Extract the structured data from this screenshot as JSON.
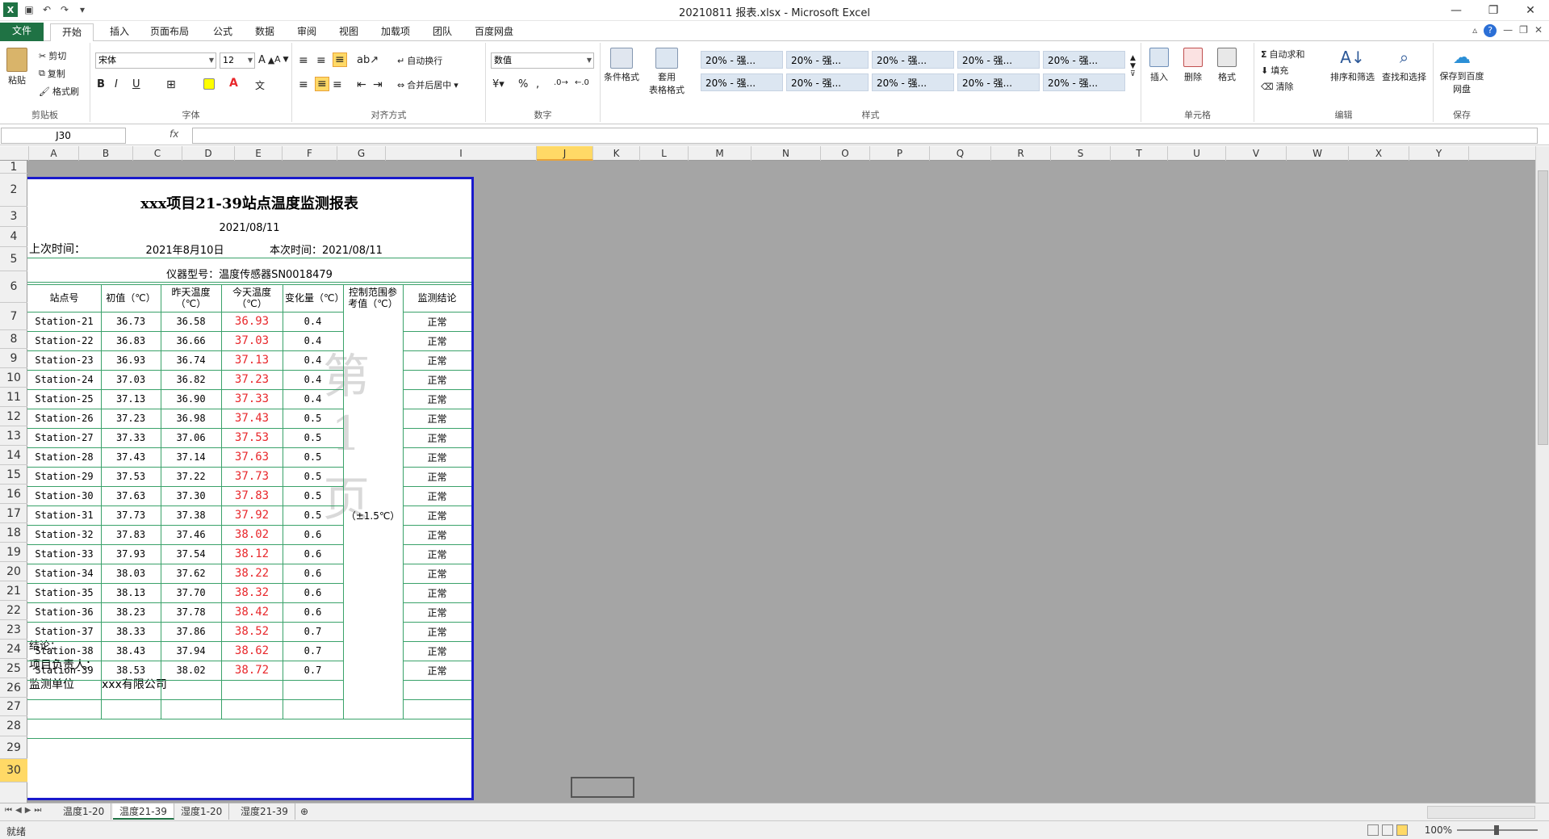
{
  "window": {
    "title": "20210811 报表.xlsx - Microsoft Excel",
    "min": "—",
    "max": "❐",
    "close": "✕"
  },
  "ribbon_tabs": [
    "文件",
    "开始",
    "插入",
    "页面布局",
    "公式",
    "数据",
    "审阅",
    "视图",
    "加载项",
    "团队",
    "百度网盘"
  ],
  "ribbon": {
    "clipboard": {
      "paste": "粘贴",
      "cut": "剪切",
      "copy": "复制",
      "format_painter": "格式刷",
      "label": "剪贴板"
    },
    "font": {
      "name": "宋体",
      "size": "12",
      "label": "字体",
      "bold": "B",
      "italic": "I",
      "underline": "U"
    },
    "alignment": {
      "wrap": "自动换行",
      "merge": "合并后居中",
      "label": "对齐方式"
    },
    "number": {
      "format": "数值",
      "percent": "%",
      "comma": ",",
      "label": "数字"
    },
    "styles": {
      "conditional": "条件格式",
      "table": "套用\n表格格式",
      "label": "样式",
      "cells": [
        "20% - 强...",
        "20% - 强...",
        "20% - 强...",
        "20% - 强...",
        "20% - 强...",
        "20% - 强...",
        "20% - 强...",
        "20% - 强...",
        "20% - 强...",
        "20% - 强..."
      ]
    },
    "cells_group": {
      "insert": "插入",
      "delete": "删除",
      "format": "格式",
      "label": "单元格"
    },
    "editing": {
      "autosum": "自动求和",
      "fill": "填充",
      "clear": "清除",
      "sort": "排序和筛选",
      "find": "查找和选择",
      "label": "编辑"
    },
    "save": {
      "button": "保存到百度网盘",
      "label": "保存"
    }
  },
  "formula_bar": {
    "name_box": "J30",
    "fx": "fx",
    "content": ""
  },
  "columns": [
    "A",
    "B",
    "C",
    "D",
    "E",
    "F",
    "G",
    "I",
    "J",
    "K",
    "L",
    "M",
    "N",
    "O",
    "P",
    "Q",
    "R",
    "S",
    "T",
    "U",
    "V",
    "W",
    "X",
    "Y"
  ],
  "selected_column": "J",
  "rows": [
    "1",
    "2",
    "3",
    "4",
    "5",
    "6",
    "7",
    "8",
    "9",
    "10",
    "11",
    "12",
    "13",
    "14",
    "15",
    "16",
    "17",
    "18",
    "19",
    "20",
    "21",
    "22",
    "23",
    "24",
    "25",
    "26",
    "27",
    "28",
    "29",
    "30"
  ],
  "selected_row": "30",
  "report": {
    "title": "xxx项目21-39站点温度监测报表",
    "date": "2021/08/11",
    "last_time_label": "上次时间：",
    "last_time_value": "2021年8月10日",
    "this_time": "本次时间：2021/08/11",
    "instrument": "仪器型号：温度传感器SN0018479",
    "headers": [
      "站点号",
      "初值（℃）",
      "昨天温度（℃）",
      "今天温度（℃）",
      "变化量（℃）",
      "控制范围参考值（℃）",
      "监测结论"
    ],
    "control_range": "（±1.5℃）",
    "data": [
      [
        "Station-21",
        "36.73",
        "36.58",
        "36.93",
        "0.4",
        "正常"
      ],
      [
        "Station-22",
        "36.83",
        "36.66",
        "37.03",
        "0.4",
        "正常"
      ],
      [
        "Station-23",
        "36.93",
        "36.74",
        "37.13",
        "0.4",
        "正常"
      ],
      [
        "Station-24",
        "37.03",
        "36.82",
        "37.23",
        "0.4",
        "正常"
      ],
      [
        "Station-25",
        "37.13",
        "36.90",
        "37.33",
        "0.4",
        "正常"
      ],
      [
        "Station-26",
        "37.23",
        "36.98",
        "37.43",
        "0.5",
        "正常"
      ],
      [
        "Station-27",
        "37.33",
        "37.06",
        "37.53",
        "0.5",
        "正常"
      ],
      [
        "Station-28",
        "37.43",
        "37.14",
        "37.63",
        "0.5",
        "正常"
      ],
      [
        "Station-29",
        "37.53",
        "37.22",
        "37.73",
        "0.5",
        "正常"
      ],
      [
        "Station-30",
        "37.63",
        "37.30",
        "37.83",
        "0.5",
        "正常"
      ],
      [
        "Station-31",
        "37.73",
        "37.38",
        "37.92",
        "0.5",
        "正常"
      ],
      [
        "Station-32",
        "37.83",
        "37.46",
        "38.02",
        "0.6",
        "正常"
      ],
      [
        "Station-33",
        "37.93",
        "37.54",
        "38.12",
        "0.6",
        "正常"
      ],
      [
        "Station-34",
        "38.03",
        "37.62",
        "38.22",
        "0.6",
        "正常"
      ],
      [
        "Station-35",
        "38.13",
        "37.70",
        "38.32",
        "0.6",
        "正常"
      ],
      [
        "Station-36",
        "38.23",
        "37.78",
        "38.42",
        "0.6",
        "正常"
      ],
      [
        "Station-37",
        "38.33",
        "37.86",
        "38.52",
        "0.7",
        "正常"
      ],
      [
        "Station-38",
        "38.43",
        "37.94",
        "38.62",
        "0.7",
        "正常"
      ],
      [
        "Station-39",
        "38.53",
        "38.02",
        "38.72",
        "0.7",
        "正常"
      ]
    ],
    "conclusion": "结论：",
    "manager": "项目负责人：",
    "unit_label": "监测单位",
    "unit_value": "xxx有限公司",
    "watermark": "第 1 页"
  },
  "sheet_tabs": [
    "温度1-20",
    "温度21-39",
    "湿度1-20",
    "湿度21-39"
  ],
  "active_sheet": "温度21-39",
  "status": {
    "ready": "就绪",
    "zoom": "100%"
  },
  "colors": {
    "excel_green": "#1f7244",
    "page_border": "#1a1acc",
    "grid_green": "#3aa26a",
    "today_red": "#e8272b",
    "sheet_bg": "#a5a5a5"
  }
}
